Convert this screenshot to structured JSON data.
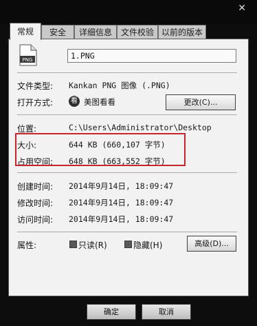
{
  "tabs": [
    {
      "label": "常规"
    },
    {
      "label": "安全"
    },
    {
      "label": "详细信息"
    },
    {
      "label": "文件校验"
    },
    {
      "label": "以前的版本"
    }
  ],
  "general": {
    "file_name": "1.PNG",
    "type_label": "文件类型:",
    "type_value": "Kankan PNG 图像 (.PNG)",
    "open_label": "打开方式:",
    "open_app": "美图看看",
    "open_app_icon_glyph": "看",
    "change_button": "更改(C)...",
    "location_label": "位置:",
    "location_value": "C:\\Users\\Administrator\\Desktop",
    "size_label": "大小:",
    "size_value": "644 KB (660,107 字节)",
    "disk_label": "占用空间:",
    "disk_value": "648 KB (663,552 字节)",
    "created_label": "创建时间:",
    "created_value": "2014年9月14日, 18:09:47",
    "modified_label": "修改时间:",
    "modified_value": "2014年9月14日, 18:09:47",
    "accessed_label": "访问时间:",
    "accessed_value": "2014年9月14日, 18:09:47",
    "attributes_label": "属性:",
    "readonly_label": "只读(R)",
    "hidden_label": "隐藏(H)",
    "advanced_button": "高级(D)..."
  },
  "footer": {
    "ok_button": "确定",
    "cancel_button": "取消"
  },
  "colors": {
    "highlight_box": "#c8242c",
    "panel_bg": "#f2f2f2"
  }
}
